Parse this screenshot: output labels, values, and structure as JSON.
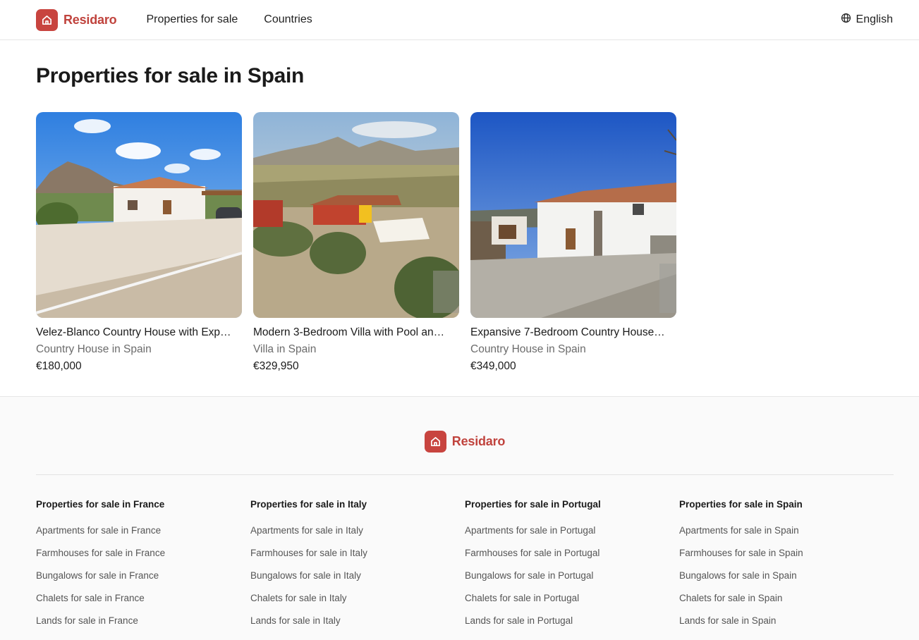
{
  "header": {
    "brand": "Residaro",
    "nav": [
      "Properties for sale",
      "Countries"
    ],
    "language": "English"
  },
  "main": {
    "title": "Properties for sale in Spain",
    "cards": [
      {
        "title": "Velez-Blanco Country House with Exp…",
        "type": "Country House in Spain",
        "price": "€180,000"
      },
      {
        "title": "Modern 3-Bedroom Villa with Pool an…",
        "type": "Villa in Spain",
        "price": "€329,950"
      },
      {
        "title": "Expansive 7-Bedroom Country House…",
        "type": "Country House in Spain",
        "price": "€349,000"
      }
    ]
  },
  "footer": {
    "brand": "Residaro",
    "columns": [
      {
        "title": "Properties for sale in France",
        "links": [
          "Apartments for sale in France",
          "Farmhouses for sale in France",
          "Bungalows for sale in France",
          "Chalets for sale in France",
          "Lands for sale in France"
        ]
      },
      {
        "title": "Properties for sale in Italy",
        "links": [
          "Apartments for sale in Italy",
          "Farmhouses for sale in Italy",
          "Bungalows for sale in Italy",
          "Chalets for sale in Italy",
          "Lands for sale in Italy"
        ]
      },
      {
        "title": "Properties for sale in Portugal",
        "links": [
          "Apartments for sale in Portugal",
          "Farmhouses for sale in Portugal",
          "Bungalows for sale in Portugal",
          "Chalets for sale in Portugal",
          "Lands for sale in Portugal"
        ]
      },
      {
        "title": "Properties for sale in Spain",
        "links": [
          "Apartments for sale in Spain",
          "Farmhouses for sale in Spain",
          "Bungalows for sale in Spain",
          "Chalets for sale in Spain",
          "Lands for sale in Spain"
        ]
      }
    ]
  },
  "colors": {
    "brand": "#c8443f",
    "text": "#1f1f1f",
    "muted": "#6b6b6b"
  },
  "icons": {
    "logo": "house-icon",
    "language": "globe-icon"
  }
}
